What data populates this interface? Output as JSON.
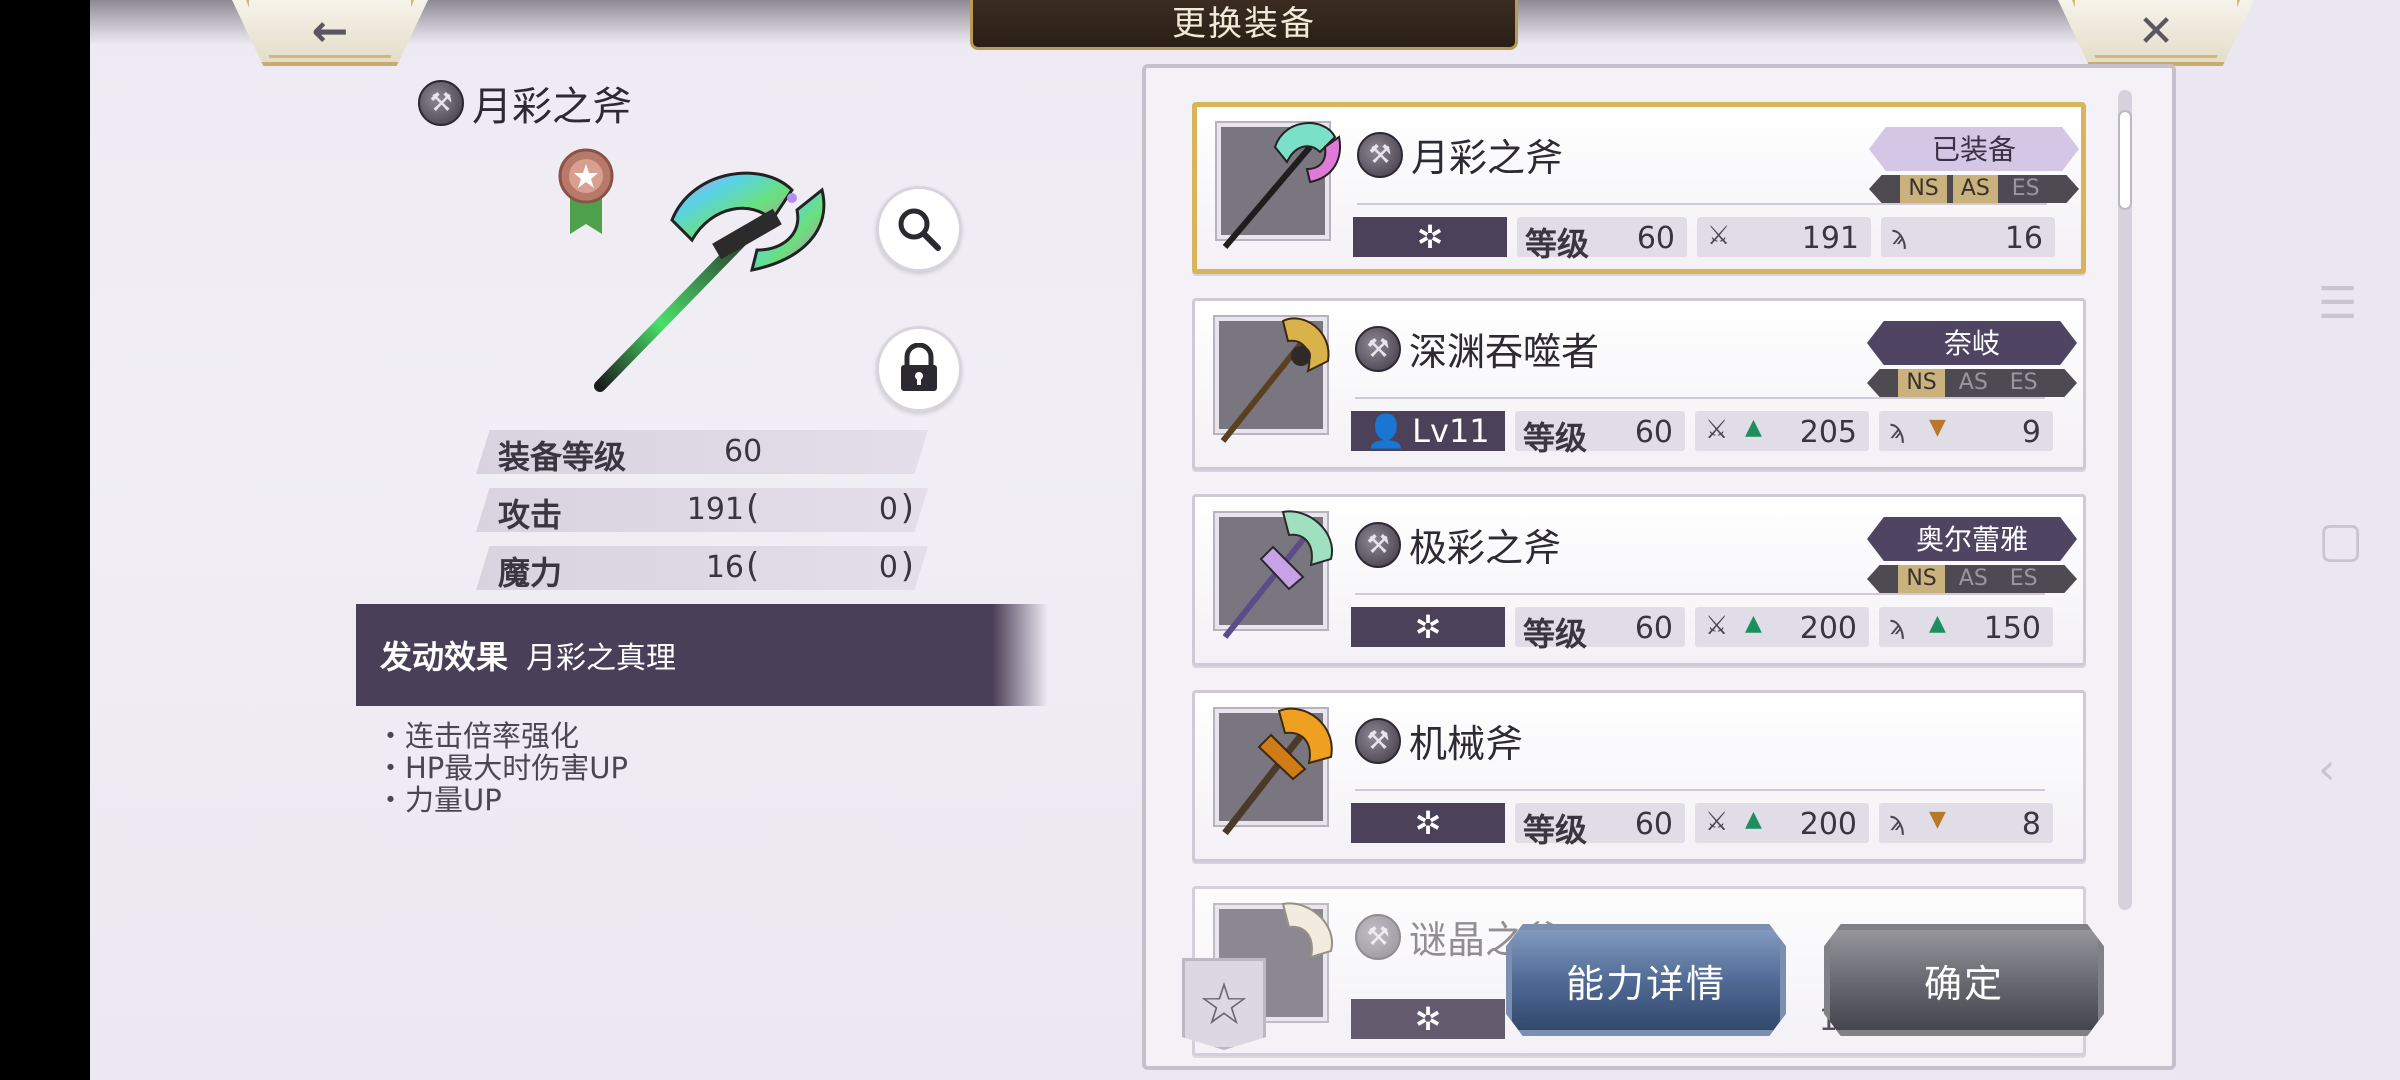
{
  "header": {
    "title": "更换装备",
    "back_glyph": "←",
    "close_glyph": "✕"
  },
  "detail": {
    "name": "月彩之斧",
    "stats": [
      {
        "label": "装备等级",
        "value": "60",
        "bonus": ""
      },
      {
        "label": "攻击",
        "value": "191",
        "bonus": "0"
      },
      {
        "label": "魔力",
        "value": "16",
        "bonus": "0"
      }
    ],
    "effect": {
      "heading": "发动效果",
      "name": "月彩之真理",
      "bullets": [
        "・连击倍率强化",
        "・HP最大时伤害UP",
        "・力量UP"
      ]
    }
  },
  "list": {
    "items": [
      {
        "name": "月彩之斧",
        "tag": "已装备",
        "level_label": "等级",
        "level": "60",
        "atk": "191",
        "mag": "16",
        "owner": "",
        "ns": "NS",
        "as": "AS",
        "es": "ES"
      },
      {
        "name": "深渊吞噬者",
        "tag": "奈岐",
        "level_label": "等级",
        "level": "60",
        "atk": "205",
        "mag": "9",
        "owner": "Lv11",
        "ns": "NS",
        "as": "AS",
        "es": "ES"
      },
      {
        "name": "极彩之斧",
        "tag": "奥尔蕾雅",
        "level_label": "等级",
        "level": "60",
        "atk": "200",
        "mag": "150",
        "owner": "",
        "ns": "NS",
        "as": "AS",
        "es": "ES"
      },
      {
        "name": "机械斧",
        "tag": "",
        "level_label": "等级",
        "level": "60",
        "atk": "200",
        "mag": "8",
        "owner": "",
        "ns": "",
        "as": "",
        "es": ""
      },
      {
        "name": "谜晶之斧",
        "atk_partial": "19"
      }
    ]
  },
  "buttons": {
    "detail": "能力详情",
    "confirm": "确定",
    "favorite": "☆"
  },
  "colors": {
    "accent_purple": "#4b4158",
    "selected_gold": "#d8b45a",
    "up_green": "#1d8f5f",
    "down_orange": "#b8782a"
  }
}
